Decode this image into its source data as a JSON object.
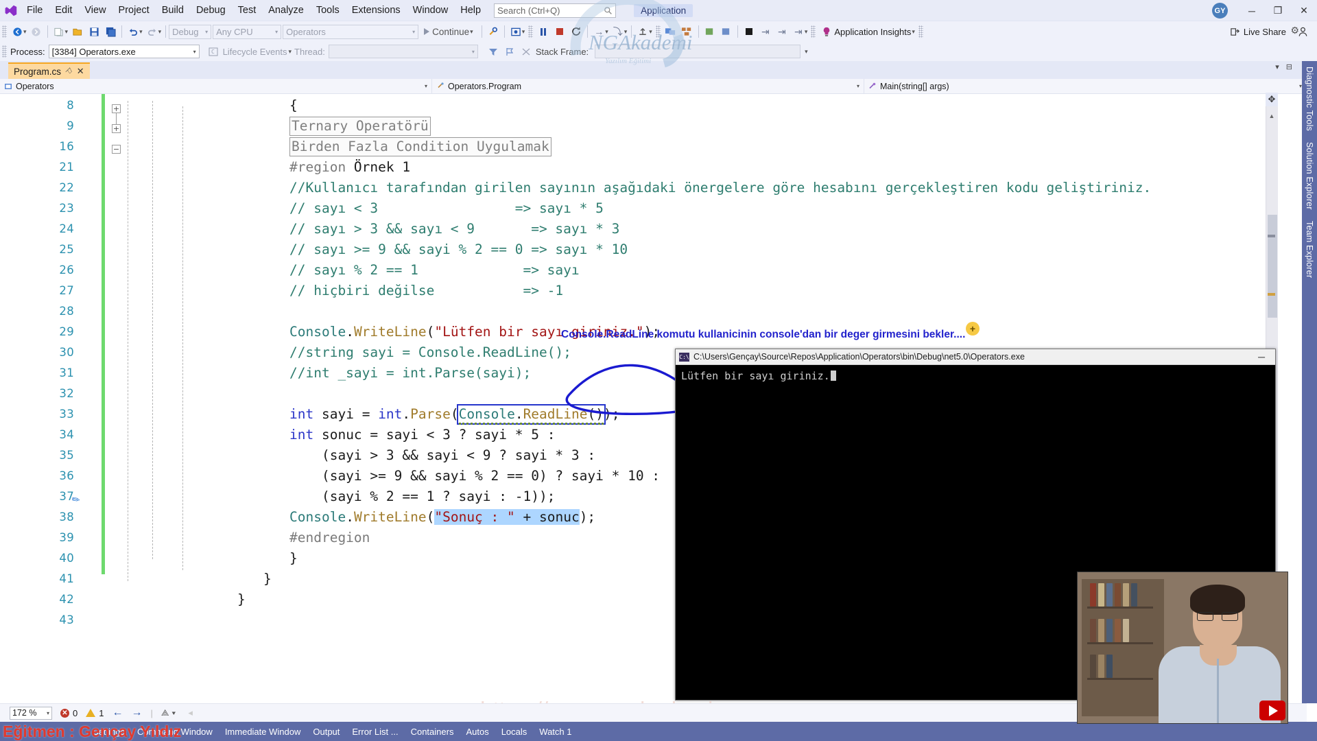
{
  "window": {
    "app_tag": "Application",
    "avatar_initials": "GY",
    "minimize": "─",
    "maximize": "❐",
    "close": "✕"
  },
  "menu": {
    "items": [
      "File",
      "Edit",
      "View",
      "Project",
      "Build",
      "Debug",
      "Test",
      "Analyze",
      "Tools",
      "Extensions",
      "Window",
      "Help"
    ],
    "search_placeholder": "Search (Ctrl+Q)"
  },
  "toolbar": {
    "config": "Debug",
    "platform": "Any CPU",
    "startup_project": "Operators",
    "continue_label": "Continue",
    "application_insights": "Application Insights",
    "live_share": "Live Share"
  },
  "debug_bar": {
    "process_label": "Process:",
    "process_value": "[3384] Operators.exe",
    "lifecycle_label": "Lifecycle Events",
    "thread_label": "Thread:",
    "thread_value": "",
    "stack_frame_label": "Stack Frame:"
  },
  "tab": {
    "title": "Program.cs",
    "pin": "⚐",
    "close": "✕"
  },
  "navbar": {
    "project": "Operators",
    "type": "Operators.Program",
    "member": "Main(string[] args)"
  },
  "right_dock": {
    "tabs": [
      "Diagnostic Tools",
      "Solution Explorer",
      "Team Explorer"
    ]
  },
  "editor": {
    "lines": [
      {
        "num": "8",
        "indent": 14,
        "tokens": [
          {
            "t": "{",
            "c": "plain"
          }
        ]
      },
      {
        "num": "9",
        "indent": 10,
        "collapsed": "Ternary Operatörü"
      },
      {
        "num": "16",
        "indent": 10,
        "collapsed": "Birden Fazla Condition Uygulamak"
      },
      {
        "num": "21",
        "indent": 10,
        "tokens": [
          {
            "t": "#region",
            "c": "prep"
          },
          {
            "t": " Örnek 1",
            "c": "plain"
          }
        ]
      },
      {
        "num": "22",
        "indent": 10,
        "tokens": [
          {
            "t": "//Kullanıcı tarafından girilen sayının aşağıdaki önergelere göre hesabını gerçekleştiren kodu geliştiriniz.",
            "c": "cmt"
          }
        ]
      },
      {
        "num": "23",
        "indent": 10,
        "tokens": [
          {
            "t": "// sayı < 3                 => sayı * 5",
            "c": "cmt"
          }
        ]
      },
      {
        "num": "24",
        "indent": 10,
        "tokens": [
          {
            "t": "// sayı > 3 && sayı < 9       => sayı * 3",
            "c": "cmt"
          }
        ]
      },
      {
        "num": "25",
        "indent": 10,
        "tokens": [
          {
            "t": "// sayı >= 9 && sayi % 2 == 0 => sayı * 10",
            "c": "cmt"
          }
        ]
      },
      {
        "num": "26",
        "indent": 10,
        "tokens": [
          {
            "t": "// sayı % 2 == 1             => sayı",
            "c": "cmt"
          }
        ]
      },
      {
        "num": "27",
        "indent": 10,
        "tokens": [
          {
            "t": "// hiçbiri değilse           => -1",
            "c": "cmt"
          }
        ]
      },
      {
        "num": "28",
        "indent": 10,
        "tokens": []
      },
      {
        "num": "29",
        "indent": 10,
        "tokens": [
          {
            "t": "Console",
            "c": "cls"
          },
          {
            "t": ".",
            "c": "plain"
          },
          {
            "t": "WriteLine",
            "c": "meth"
          },
          {
            "t": "(",
            "c": "plain"
          },
          {
            "t": "\"Lütfen bir sayı giriniz.\"",
            "c": "str"
          },
          {
            "t": ");",
            "c": "plain"
          }
        ]
      },
      {
        "num": "30",
        "indent": 10,
        "tokens": [
          {
            "t": "//string sayi = Console.ReadLine();",
            "c": "cmt"
          }
        ]
      },
      {
        "num": "31",
        "indent": 10,
        "tokens": [
          {
            "t": "//int _sayi = int.Parse(sayi);",
            "c": "cmt"
          }
        ]
      },
      {
        "num": "32",
        "indent": 10,
        "tokens": []
      },
      {
        "num": "33",
        "indent": 10,
        "special": "parse-line",
        "pre": [
          {
            "t": "int",
            "c": "kw"
          },
          {
            "t": " sayi ",
            "c": "plain"
          },
          {
            "t": "=",
            "c": "plain"
          },
          {
            "t": " ",
            "c": "plain"
          },
          {
            "t": "int",
            "c": "kw"
          },
          {
            "t": ".",
            "c": "plain"
          },
          {
            "t": "Parse",
            "c": "meth"
          },
          {
            "t": "(",
            "c": "plain"
          }
        ],
        "boxed": "Console.ReadLine()",
        "post": [
          {
            "t": ");",
            "c": "plain"
          }
        ]
      },
      {
        "num": "34",
        "indent": 10,
        "tokens": [
          {
            "t": "int",
            "c": "kw"
          },
          {
            "t": " sonuc = sayi < ",
            "c": "plain"
          },
          {
            "t": "3",
            "c": "num"
          },
          {
            "t": " ? sayi * ",
            "c": "plain"
          },
          {
            "t": "5",
            "c": "num"
          },
          {
            "t": " :",
            "c": "plain"
          }
        ]
      },
      {
        "num": "35",
        "indent": 10,
        "tokens": [
          {
            "t": "    (sayi > 3 && sayi < 9 ? sayi * 3 :",
            "c": "plain"
          }
        ]
      },
      {
        "num": "36",
        "indent": 10,
        "tokens": [
          {
            "t": "    (sayi >= 9 && sayi % 2 == 0) ? sayi * 10 :",
            "c": "plain"
          }
        ]
      },
      {
        "num": "37",
        "indent": 10,
        "tokens": [
          {
            "t": "    (sayi % 2 == 1 ? sayi : -1));",
            "c": "plain"
          }
        ]
      },
      {
        "num": "38",
        "indent": 10,
        "special": "sonuc-line",
        "pre": [
          {
            "t": "Console",
            "c": "cls"
          },
          {
            "t": ".",
            "c": "plain"
          },
          {
            "t": "WriteLine",
            "c": "meth"
          },
          {
            "t": "(",
            "c": "plain"
          }
        ],
        "sel_str": "\"Sonuç : \"",
        "sel_rest": " + sonuc",
        "post": [
          {
            "t": ");",
            "c": "plain"
          }
        ]
      },
      {
        "num": "39",
        "indent": 10,
        "tokens": [
          {
            "t": "#endregion",
            "c": "prep"
          }
        ]
      },
      {
        "num": "40",
        "indent": 10,
        "tokens": [
          {
            "t": "}",
            "c": "plain"
          }
        ]
      },
      {
        "num": "41",
        "indent": 6,
        "tokens": [
          {
            "t": "}",
            "c": "plain"
          }
        ]
      },
      {
        "num": "42",
        "indent": 2,
        "tokens": [
          {
            "t": "}",
            "c": "plain"
          }
        ]
      },
      {
        "num": "43",
        "indent": 0,
        "tokens": []
      }
    ]
  },
  "annotation": {
    "text": "Console.ReadLine komutu kullanicinin console'dan bir deger girmesini bekler....",
    "plus": "+"
  },
  "console": {
    "title": "C:\\Users\\Gençay\\Source\\Repos\\Application\\Operators\\bin\\Debug\\net5.0\\Operators.exe",
    "minimize": "─",
    "output": "Lütfen bir sayı giriniz."
  },
  "status": {
    "zoom": "172 %",
    "errors": "0",
    "warnings": "1",
    "back_arrow": "←",
    "forward_arrow": "→"
  },
  "bottom_dock": {
    "tabs": [
      "Settings",
      "Command Window",
      "Immediate Window",
      "Output",
      "Error List ...",
      "Containers",
      "Autos",
      "Locals",
      "Watch 1"
    ]
  },
  "overlay": {
    "trainer": "Eğitmen : Gençay Yıldız",
    "url": "https://www.ngakademi.com",
    "brand": "NGAkademi",
    "brand_sub": "Yazılım Eğitimi"
  },
  "colors": {
    "accent_blue": "#5d6ba6",
    "tab_orange": "#fdd9a0",
    "ink_blue": "#2222cc",
    "error_red": "#c0392b",
    "warn_yellow": "#e8b023",
    "changebar_green": "#6ed96e"
  }
}
